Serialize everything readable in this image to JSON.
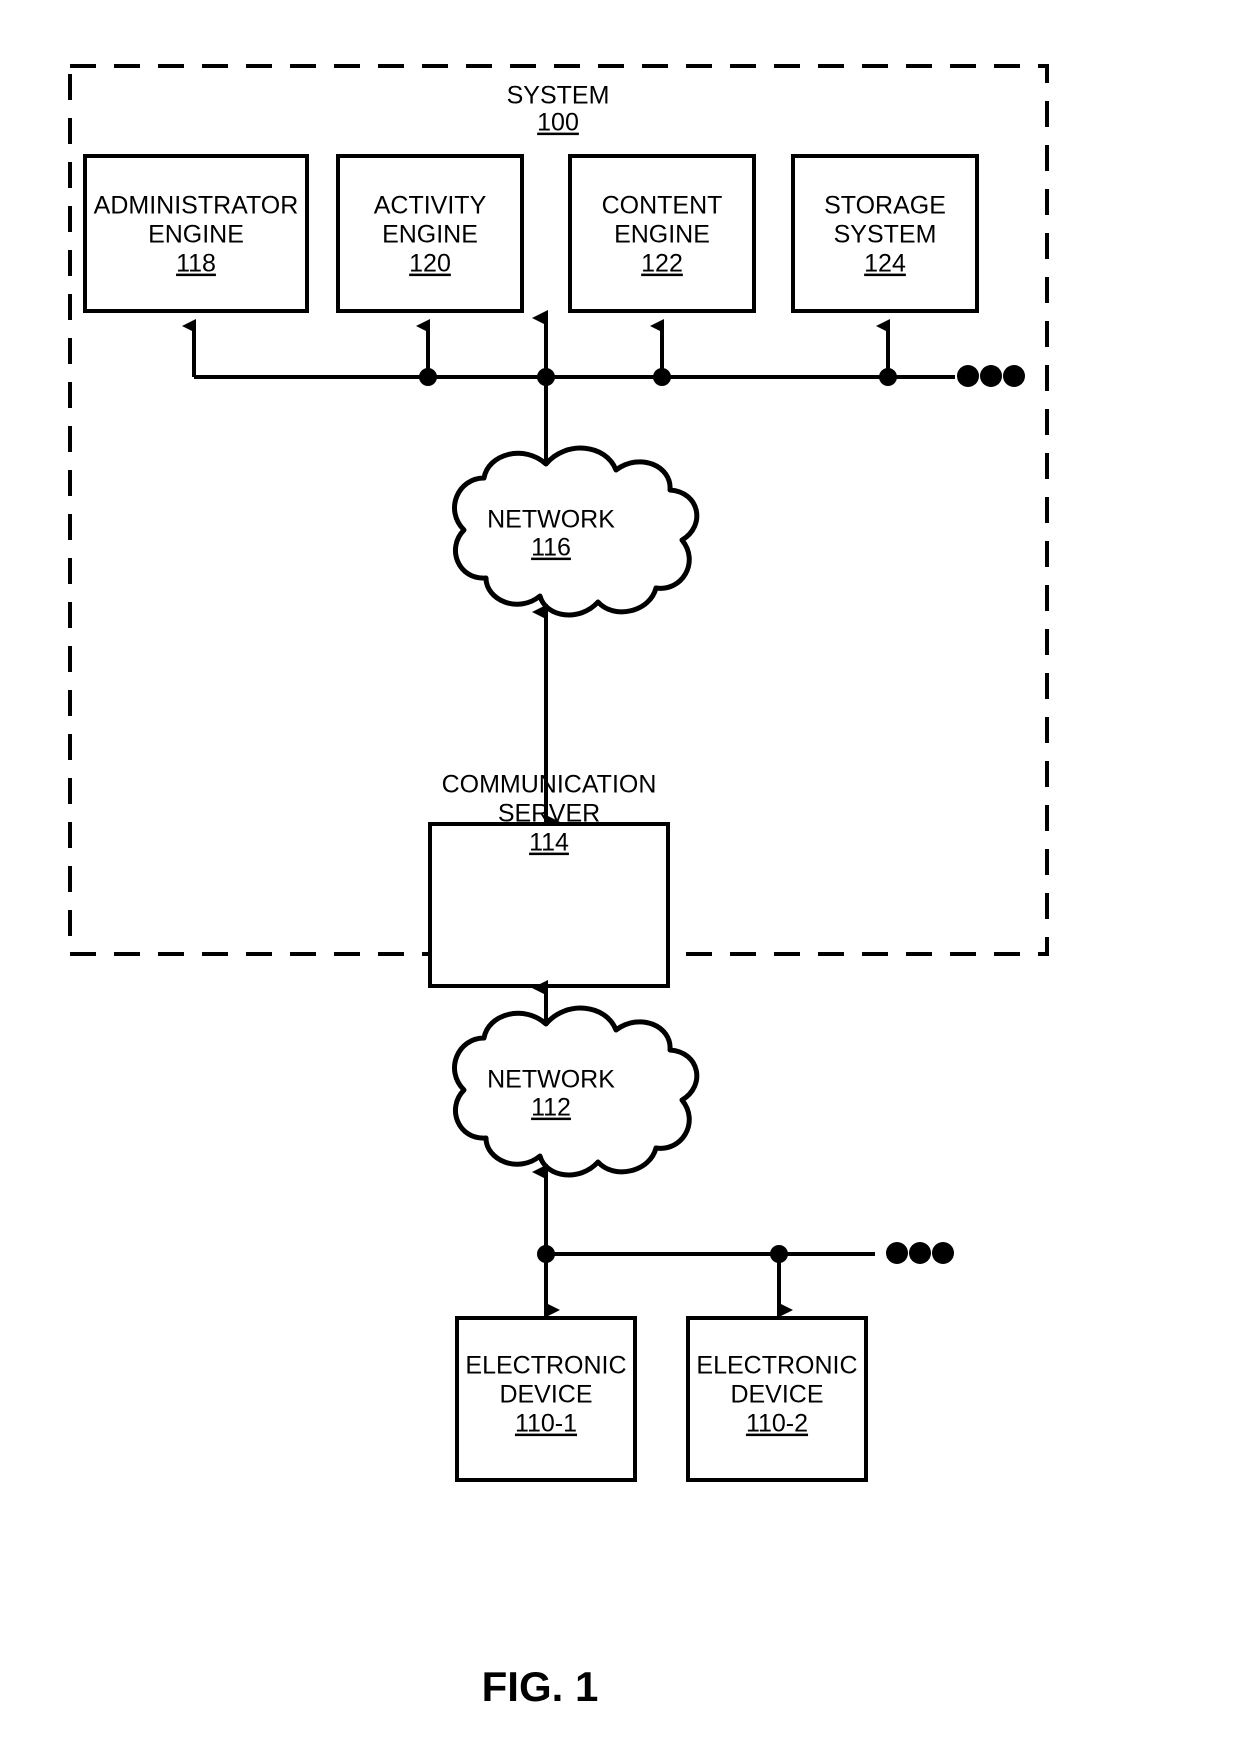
{
  "figure": {
    "caption": "FIG. 1",
    "system_title": "SYSTEM",
    "system_ref": "100"
  },
  "engines": [
    {
      "line1": "ADMINISTRATOR",
      "line2": "ENGINE",
      "ref": "118"
    },
    {
      "line1": "ACTIVITY",
      "line2": "ENGINE",
      "ref": "120"
    },
    {
      "line1": "CONTENT",
      "line2": "ENGINE",
      "ref": "122"
    },
    {
      "line1": "STORAGE",
      "line2": "SYSTEM",
      "ref": "124"
    }
  ],
  "networks": [
    {
      "label": "NETWORK",
      "ref": "116"
    },
    {
      "label": "NETWORK",
      "ref": "112"
    }
  ],
  "communication_server": {
    "line1": "COMMUNICATION",
    "line2": "SERVER",
    "ref": "114"
  },
  "devices": [
    {
      "line1": "ELECTRONIC",
      "line2": "DEVICE",
      "ref": "110-1"
    },
    {
      "line1": "ELECTRONIC",
      "line2": "DEVICE",
      "ref": "110-2"
    }
  ],
  "ellipsis": {
    "top_bus": "•••",
    "bottom_bus": "•••"
  },
  "colors": {
    "stroke": "#000000",
    "background": "#ffffff"
  }
}
